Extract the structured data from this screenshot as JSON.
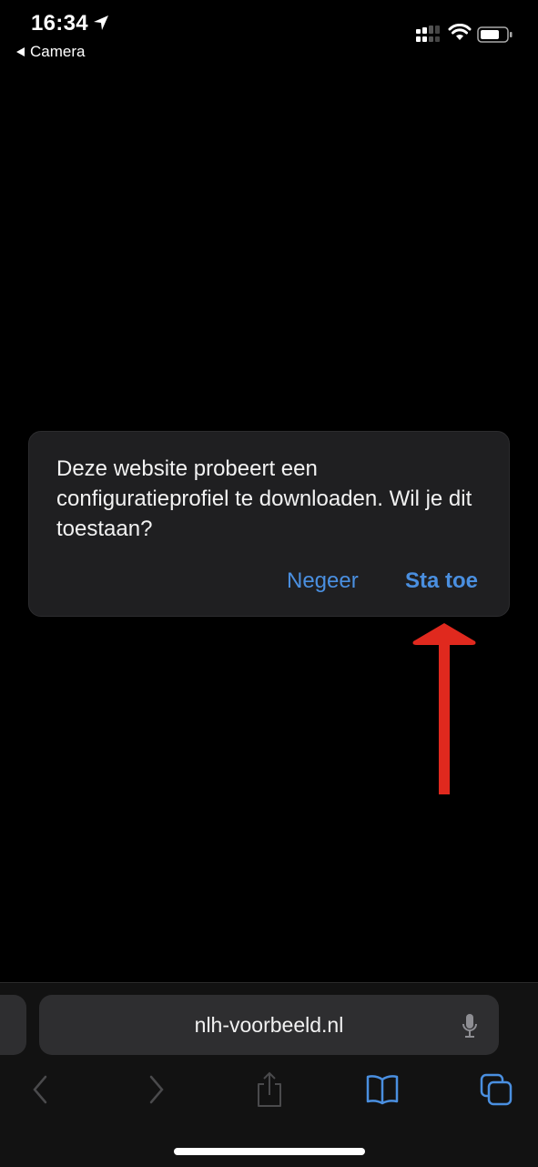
{
  "status_bar": {
    "time": "16:34",
    "back_app": "Camera",
    "icons": [
      "location-arrow-icon",
      "cellular-signal-icon",
      "wifi-icon",
      "battery-icon"
    ]
  },
  "dialog": {
    "message": "Deze website probeert een configuratieprofiel te downloaden. Wil je dit toestaan?",
    "ignore_label": "Negeer",
    "allow_label": "Sta toe",
    "accent_color": "#4a8fe0"
  },
  "annotation": {
    "arrow_color": "#e0291e",
    "points_to": "Sta toe"
  },
  "browser": {
    "url": "nlh-voorbeeld.nl",
    "toolbar": [
      "back-icon",
      "forward-icon",
      "share-icon",
      "bookmarks-icon",
      "tabs-icon"
    ]
  }
}
